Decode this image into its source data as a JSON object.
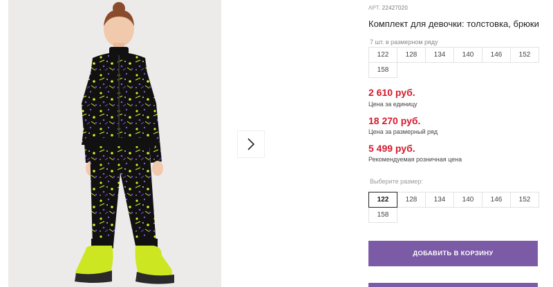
{
  "product": {
    "sku_label": "АРТ.",
    "sku_value": "22427020",
    "title": "Комплект для девочки: толстовка, брюки"
  },
  "size_row": {
    "note": "7 шт. в размерном ряду",
    "sizes": [
      "122",
      "128",
      "134",
      "140",
      "146",
      "152",
      "158"
    ]
  },
  "prices": {
    "unit_price": "2 610 руб.",
    "unit_label": "Цена за единицу",
    "row_price": "18 270 руб.",
    "row_label": "Цена за размерный ряд",
    "retail_price": "5 499 руб.",
    "retail_label": "Рекомендуемая розничная цена"
  },
  "size_select": {
    "label": "Выберите размер:",
    "sizes": [
      "122",
      "128",
      "134",
      "140",
      "146",
      "152",
      "158"
    ],
    "selected": "122"
  },
  "actions": {
    "add_to_cart": "ДОБАВИТЬ В КОРЗИНУ"
  },
  "colors": {
    "price_red": "#d4192c",
    "button_purple": "#7b5aa6"
  },
  "icons": {
    "next_arrow": "chevron-right-icon"
  }
}
